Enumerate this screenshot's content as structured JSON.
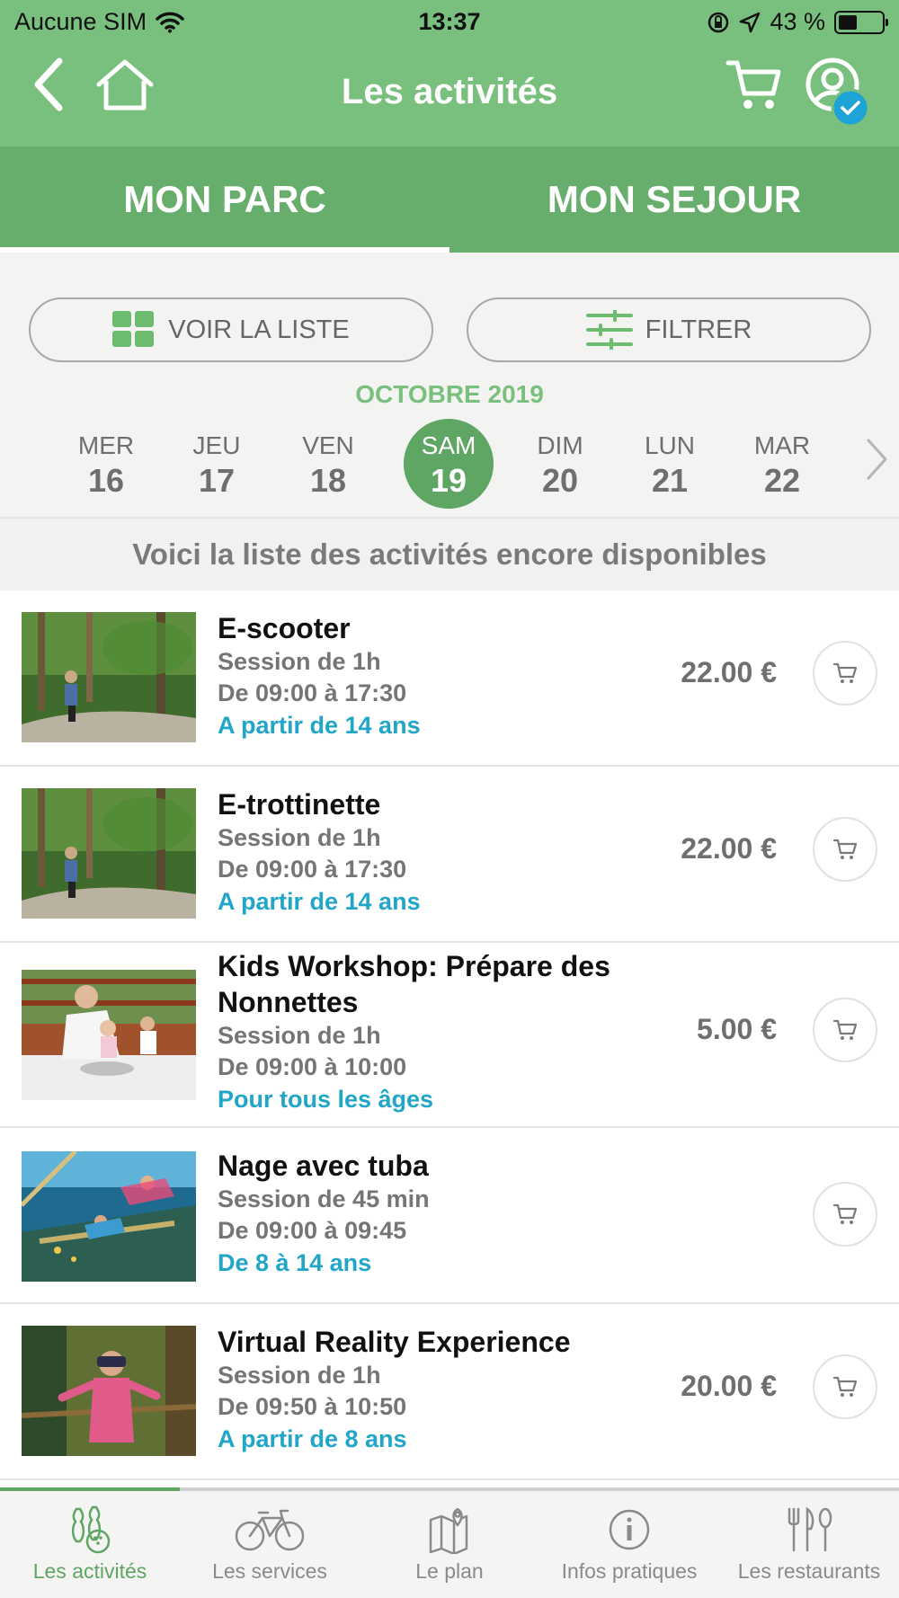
{
  "status_bar": {
    "carrier": "Aucune SIM",
    "time": "13:37",
    "battery": "43 %",
    "battery_level": 0.43
  },
  "nav": {
    "title": "Les activités",
    "icons": [
      "back-icon",
      "home-icon",
      "cart-icon",
      "account-icon",
      "verified-check-icon"
    ]
  },
  "tabs": [
    {
      "label": "MON PARC",
      "active": true
    },
    {
      "label": "MON SEJOUR",
      "active": false
    }
  ],
  "controls": {
    "view_list_label": "VOIR LA LISTE",
    "filter_label": "FILTRER",
    "month": "OCTOBRE 2019"
  },
  "days": [
    {
      "name": "MER",
      "num": "16",
      "selected": false
    },
    {
      "name": "JEU",
      "num": "17",
      "selected": false
    },
    {
      "name": "VEN",
      "num": "18",
      "selected": false
    },
    {
      "name": "SAM",
      "num": "19",
      "selected": true
    },
    {
      "name": "DIM",
      "num": "20",
      "selected": false
    },
    {
      "name": "LUN",
      "num": "21",
      "selected": false
    },
    {
      "name": "MAR",
      "num": "22",
      "selected": false
    }
  ],
  "banner": "Voici la liste des activités encore disponibles",
  "activities": [
    {
      "name": "E-scooter",
      "session": "Session de 1h",
      "hours": "De 09:00 à 17:30",
      "age": "A partir de 14 ans",
      "price": "22.00 €"
    },
    {
      "name": "E-trottinette",
      "session": "Session de 1h",
      "hours": "De 09:00 à 17:30",
      "age": "A partir de 14 ans",
      "price": "22.00 €"
    },
    {
      "name": "Kids Workshop: Prépare des Nonnettes",
      "session": "Session de 1h",
      "hours": "De 09:00 à 10:00",
      "age": "Pour tous les âges",
      "price": "5.00 €"
    },
    {
      "name": "Nage avec tuba",
      "session": "Session de 45 min",
      "hours": "De 09:00 à 09:45",
      "age": "De 8 à 14 ans",
      "price": ""
    },
    {
      "name": "Virtual Reality Experience",
      "session": "Session de 1h",
      "hours": "De 09:50 à 10:50",
      "age": "A partir de 8 ans",
      "price": "20.00 €"
    }
  ],
  "bottom_tabs": [
    {
      "label": "Les activités",
      "icon": "bowling-icon",
      "active": true
    },
    {
      "label": "Les services",
      "icon": "bicycle-icon",
      "active": false
    },
    {
      "label": "Le plan",
      "icon": "map-icon",
      "active": false
    },
    {
      "label": "Infos pratiques",
      "icon": "info-icon",
      "active": false
    },
    {
      "label": "Les restaurants",
      "icon": "cutlery-icon",
      "active": false
    }
  ],
  "colors": {
    "nav_green": "#79bf7d",
    "tab_green": "#67ad6b",
    "selected_day": "#5fa564",
    "age_text": "#22a6c8"
  }
}
